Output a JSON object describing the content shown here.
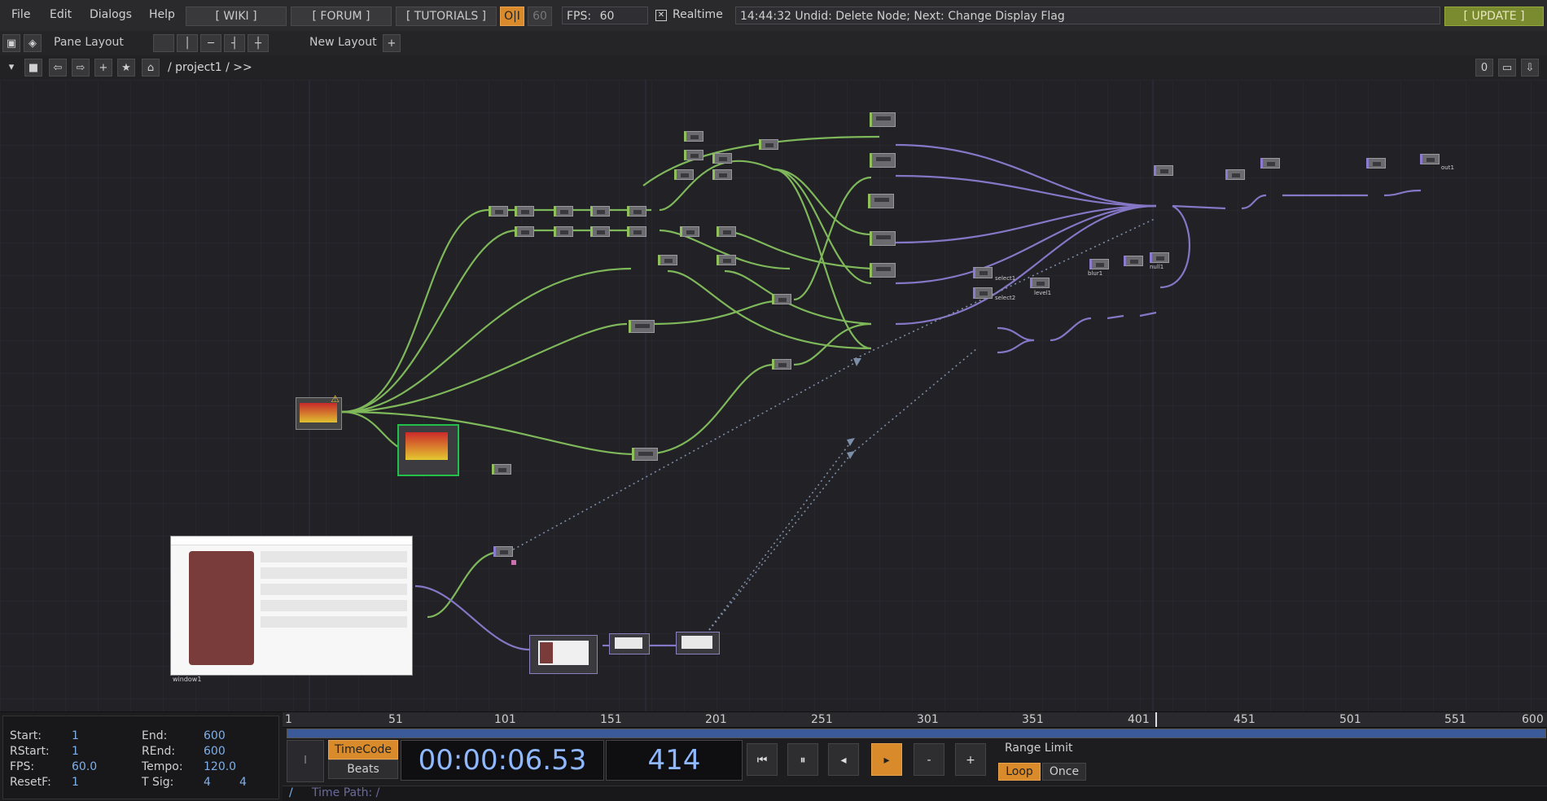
{
  "menubar": {
    "items": [
      "File",
      "Edit",
      "Dialogs",
      "Help"
    ],
    "links": [
      "[ WIKI ]",
      "[ FORUM ]",
      "[ TUTORIALS ]"
    ],
    "oi_label": "O|I",
    "fps_cap": "60",
    "fps_label": "FPS:",
    "fps_value": "60",
    "realtime_label": "Realtime",
    "status": "14:44:32 Undid: Delete Node; Next: Change Display Flag",
    "update_label": "[ UPDATE ]"
  },
  "panebar": {
    "pane_layout_label": "Pane Layout",
    "new_layout_label": "New Layout",
    "add": "+"
  },
  "pathbar": {
    "path": "/ project1 / >>",
    "right_counter": "0"
  },
  "network": {
    "nodes": [
      {
        "label": "select1"
      },
      {
        "label": "select2"
      },
      {
        "label": "level1"
      },
      {
        "label": "blur1"
      },
      {
        "label": "null1"
      },
      {
        "label": "out1"
      }
    ],
    "window_label": "window1"
  },
  "timeline": {
    "ruler_ticks": [
      "1",
      "51",
      "101",
      "151",
      "201",
      "251",
      "301",
      "351",
      "401",
      "451",
      "501",
      "551",
      "600"
    ],
    "stats": {
      "start_label": "Start:",
      "start": "1",
      "end_label": "End:",
      "end": "600",
      "rstart_label": "RStart:",
      "rstart": "1",
      "rend_label": "REnd:",
      "rend": "600",
      "fps_label": "FPS:",
      "fps": "60.0",
      "tempo_label": "Tempo:",
      "tempo": "120.0",
      "resetf_label": "ResetF:",
      "resetf": "1",
      "tsig_label": "T Sig:",
      "tsig_a": "4",
      "tsig_b": "4"
    },
    "timecode_btn": "TimeCode",
    "beats_btn": "Beats",
    "timecode": "00:00:06.53",
    "frame": "414",
    "range_limit_label": "Range Limit",
    "loop_btn": "Loop",
    "once_btn": "Once",
    "time_path": "Time Path: /",
    "slash": "/",
    "minus": "-",
    "plus": "+"
  },
  "colors": {
    "accent_orange": "#d98a2b",
    "wire_green": "#7fb85a",
    "wire_purple": "#8577c6",
    "update_green": "#7a8a2e"
  }
}
